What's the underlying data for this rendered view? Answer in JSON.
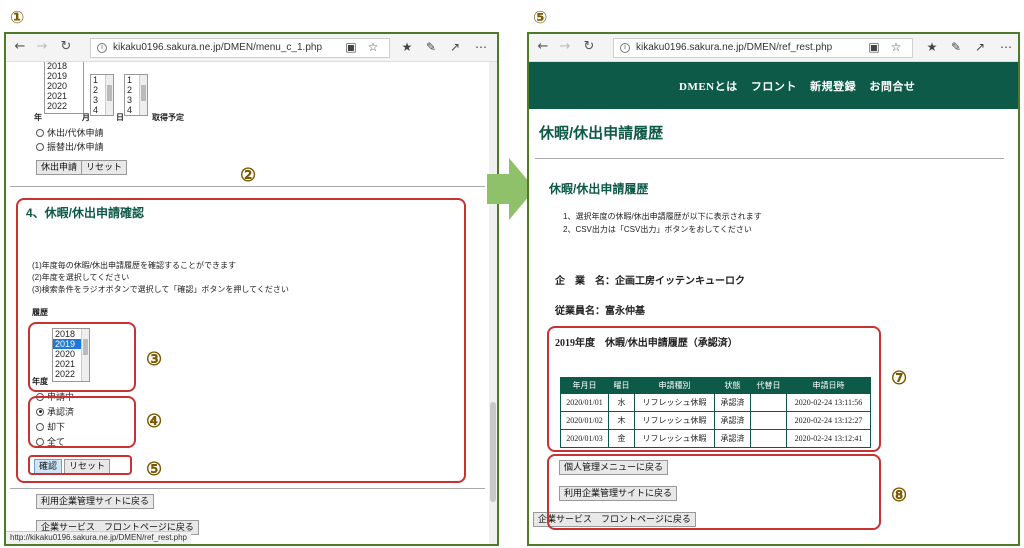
{
  "annotations": {
    "left_window": "①",
    "right_window": "⑤",
    "section": "②",
    "year_list": "③",
    "radio_group": "④",
    "buttons": "⑤",
    "result_table": "⑦",
    "bottom_buttons": "⑧"
  },
  "left": {
    "url": "kikaku0196.sakura.ne.jp/DMEN/menu_c_1.php",
    "top_year_list": [
      "2018",
      "2019",
      "2020",
      "2021",
      "2022"
    ],
    "month_list": [
      "1",
      "2",
      "3",
      "4"
    ],
    "day_list": [
      "1",
      "2",
      "3",
      "4"
    ],
    "label_year": "年",
    "label_month": "月",
    "label_day": "日",
    "label_plan": "取得予定",
    "radio_top": [
      "休出/代休申請",
      "振替出/休申請"
    ],
    "btn_submit": "休出申請",
    "btn_reset": "リセット",
    "section_title": "4、休暇/休出申請確認",
    "instructions": [
      "(1)年度毎の休暇/休出申請履歴を確認することができます",
      "(2)年度を選択してください",
      "(3)検索条件をラジオボタンで選択して「確認」ボタンを押してください"
    ],
    "history_label": "履歴",
    "year_label": "年度",
    "year_list": [
      "2018",
      "2019",
      "2020",
      "2021",
      "2022"
    ],
    "year_selected": "2019",
    "status_radios": [
      "申請中",
      "承認済",
      "却下",
      "全て"
    ],
    "status_selected": "承認済",
    "btn_confirm": "確認",
    "btn_reset2": "リセット",
    "btn_back_company": "利用企業管理サイトに戻る",
    "btn_back_front": "企業サービス　フロントページに戻る",
    "status_url": "http://kikaku0196.sakura.ne.jp/DMEN/ref_rest.php"
  },
  "right": {
    "url": "kikaku0196.sakura.ne.jp/DMEN/ref_rest.php",
    "nav": [
      "DMENとは",
      "フロント",
      "新規登録",
      "お問合せ"
    ],
    "page_title": "休暇/休出申請履歴",
    "sub_title": "休暇/休出申請履歴",
    "notes": [
      "1、選択年度の休暇/休出申請履歴が以下に表示されます",
      "2、CSV出力は「CSV出力」ボタンをおしてください"
    ],
    "company_label": "企　業　名：企画工房イッテンキューロク",
    "employee_label": "従業員名：富永仲基",
    "table_title": "2019年度　休暇/休出申請履歴（承認済）",
    "table_headers": [
      "年月日",
      "曜日",
      "申請種別",
      "状態",
      "代替日",
      "申請日時"
    ],
    "table_rows": [
      [
        "2020/01/01",
        "水",
        "リフレッシュ休暇",
        "承認済",
        "",
        "2020-02-24 13:11:56"
      ],
      [
        "2020/01/02",
        "木",
        "リフレッシュ休暇",
        "承認済",
        "",
        "2020-02-24 13:12:27"
      ],
      [
        "2020/01/03",
        "金",
        "リフレッシュ休暇",
        "承認済",
        "",
        "2020-02-24 13:12:41"
      ]
    ],
    "btn_personal_menu": "個人管理メニューに戻る",
    "btn_company_site": "利用企業管理サイトに戻る",
    "btn_front_page": "企業サービス　フロントページに戻る"
  },
  "colors": {
    "brand_green": "#0e5a48",
    "annotation_red": "#c83232",
    "frame_green": "#4e7a2a",
    "arrow_green": "#8ec16a"
  }
}
